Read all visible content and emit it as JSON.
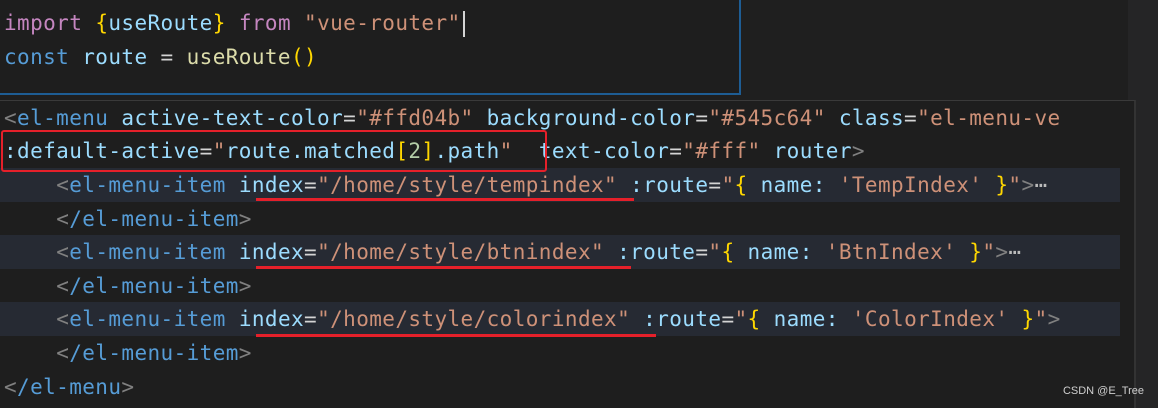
{
  "top_editor": {
    "line1": {
      "import": "import",
      "brace_open": "{",
      "name": "useRoute",
      "brace_close": "}",
      "from": "from",
      "module": "\"vue-router\""
    },
    "line2": {
      "const": "const",
      "var": "route",
      "eq": "=",
      "fn": "useRoute",
      "parens": "()"
    }
  },
  "bottom_editor": {
    "l1": {
      "lt": "<",
      "tag": "el-menu",
      "a1": "active-text-color",
      "v1": "\"#ffd04b\"",
      "a2": "background-color",
      "v2": "\"#545c64\"",
      "a3": "class",
      "v3": "\"el-menu-ve"
    },
    "l2": {
      "attr": ":default-active",
      "q1": "\"",
      "v_pre": "route.matched",
      "b_open": "[",
      "idx": "2",
      "b_close": "]",
      "v_post": ".path",
      "q2": "\"",
      "a2": "text-color",
      "v2": "\"#fff\"",
      "a3": "router",
      "gt": ">"
    },
    "items": [
      {
        "tag": "el-menu-item",
        "index_attr": "index",
        "index_val": "\"/home/style/tempindex\"",
        "route_attr": ":route",
        "route_name": "'TempIndex'",
        "fold": "⋯"
      },
      {
        "tag": "el-menu-item",
        "index_attr": "index",
        "index_val": "\"/home/style/btnindex\"",
        "route_attr": ":route",
        "route_name": "'BtnIndex'",
        "fold": "⋯"
      },
      {
        "tag": "el-menu-item",
        "index_attr": "index",
        "index_val": "\"/home/style/colorindex\"",
        "route_attr": ":route",
        "route_name": "'ColorIndex'",
        "fold": ""
      }
    ],
    "close_item": "/el-menu-item",
    "close_menu": "/el-menu",
    "name_key": "name:",
    "eq": "=",
    "quote": "\"",
    "brace_open": "{",
    "brace_close": "}",
    "lt": "<",
    "gt": ">"
  },
  "watermark": "CSDN @E_Tree",
  "colors": {
    "highlight_red": "#e5202a",
    "editor_bg": "#1e1e1e",
    "pane_border": "#1e5d94"
  }
}
